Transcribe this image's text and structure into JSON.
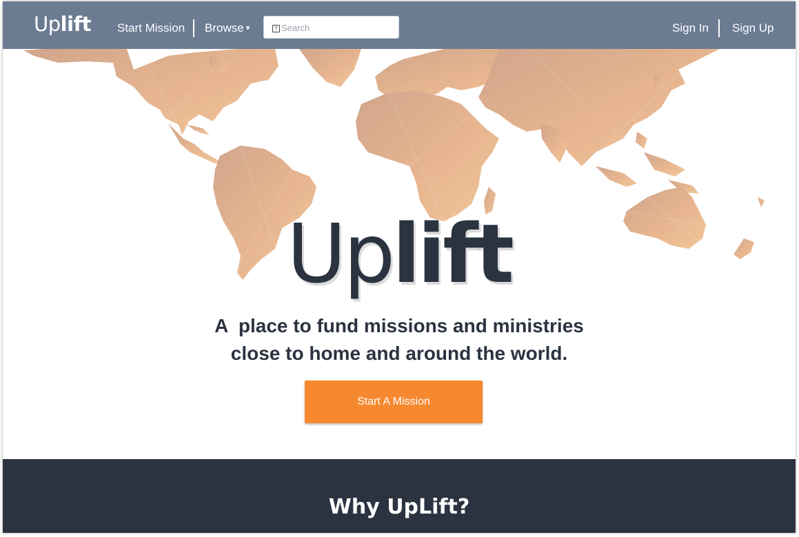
{
  "nav": {
    "logo_light": "Up",
    "logo_bold": "lift",
    "start_mission": "Start Mission",
    "browse": "Browse",
    "browse_caret": "▾",
    "search_placeholder": "Search",
    "sign_in": "Sign In",
    "sign_up": "Sign Up"
  },
  "hero": {
    "logo_light": "Up",
    "logo_bold": "lift",
    "tagline_line1": "A  place to fund missions and ministries",
    "tagline_line2": "close to home and around the world.",
    "cta_label": "Start A Mission"
  },
  "why": {
    "title": "Why UpLift?"
  },
  "colors": {
    "navbar": "#6b7b92",
    "dark": "#2b3340",
    "accent": "#f6882f",
    "map": "#e8b48a"
  },
  "icons": {
    "search": "search-icon",
    "browse_dropdown": "chevron-down-icon"
  }
}
